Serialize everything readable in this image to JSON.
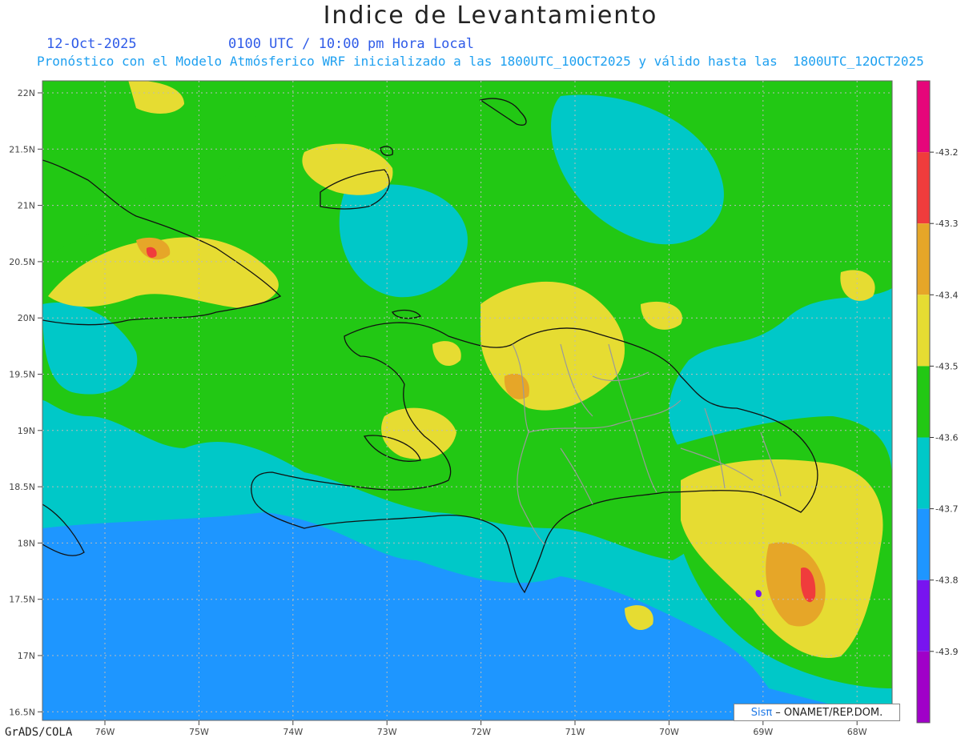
{
  "title": "Indice de Levantamiento",
  "date": "12-Oct-2025",
  "time": "0100 UTC / 10:00 pm Hora Local",
  "subtitle": "Pronóstico con el Modelo Atmósferico WRF inicializado a las 1800UTC_10OCT2025 y válido hasta las  1800UTC_12OCT2025",
  "footer": "GrADS/COLA",
  "credit": {
    "logo": "Sisπ",
    "org": "– ONAMET/REP.DOM."
  },
  "axes": {
    "lat_labels": [
      "22N",
      "21.5N",
      "21N",
      "20.5N",
      "20N",
      "19.5N",
      "19N",
      "18.5N",
      "18N",
      "17.5N",
      "17N",
      "16.5N"
    ],
    "lon_labels": [
      "76W",
      "75W",
      "74W",
      "73W",
      "72W",
      "71W",
      "70W",
      "69W",
      "68W"
    ]
  },
  "colorbar": {
    "colors": [
      "#e6067a",
      "#f03c3c",
      "#e6a628",
      "#e6dc32",
      "#22c814",
      "#00c8c8",
      "#1e96ff",
      "#7814f0",
      "#a000c8"
    ],
    "labels": [
      "-43.2",
      "-43.3",
      "-43.4",
      "-43.5",
      "-43.6",
      "-43.7",
      "-43.8",
      "-43.9"
    ]
  }
}
